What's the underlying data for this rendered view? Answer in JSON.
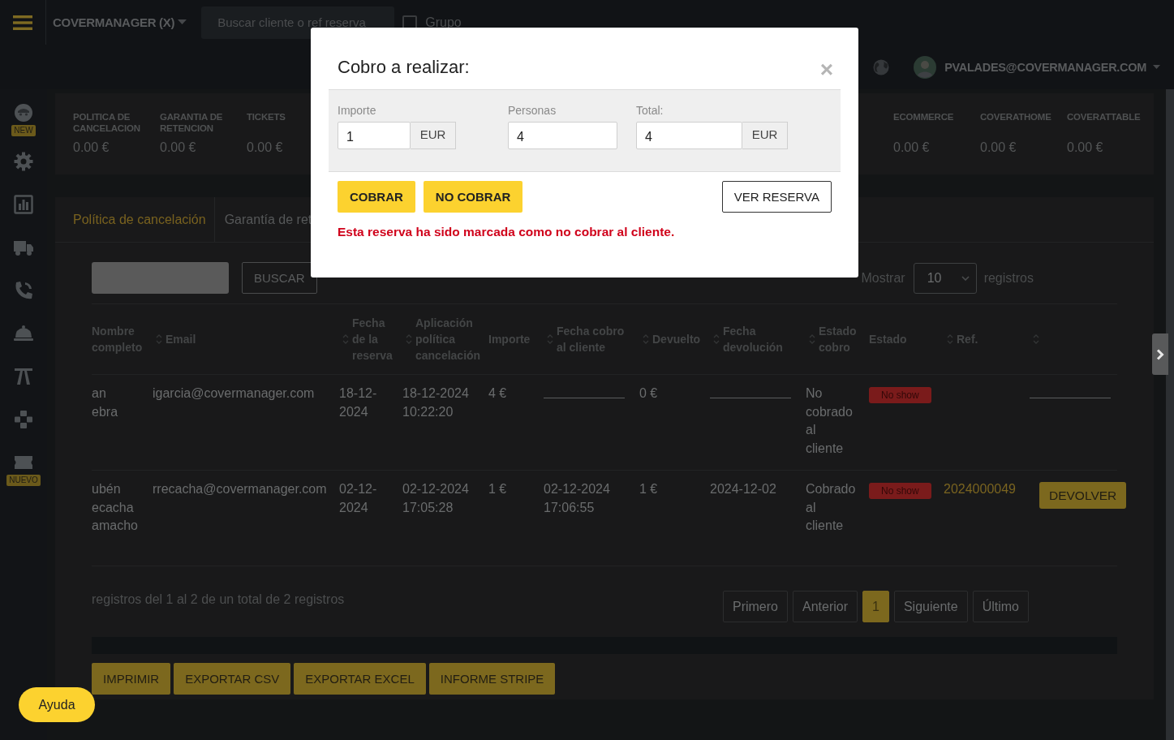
{
  "topbar": {
    "brand": "COVERMANAGER (X)",
    "search": {
      "placeholder": "Buscar cliente o ref reserva"
    },
    "group_checkbox": {
      "label": "Grupo",
      "checked": false
    },
    "user": {
      "email": "PVALADES@COVERMANAGER.COM"
    }
  },
  "sidebar": {
    "items": [
      {
        "kind": "face",
        "badge": "NEW"
      },
      {
        "kind": "gear"
      },
      {
        "kind": "chart"
      },
      {
        "kind": "truck"
      },
      {
        "kind": "phone"
      },
      {
        "kind": "cloche"
      },
      {
        "kind": "road"
      },
      {
        "kind": "gamepad"
      },
      {
        "kind": "ticket",
        "badge": "NUEVO"
      }
    ]
  },
  "stats": {
    "left": [
      {
        "label": "POLITICA DE CANCELACION",
        "value": "0.00 €"
      },
      {
        "label": "GARANTIA DE RETENCION",
        "value": "0.00 €"
      },
      {
        "label": "TICKETS",
        "value": "0.00 €"
      }
    ],
    "right": [
      {
        "label": "ECOMMERCE",
        "value": "0.00 €"
      },
      {
        "label": "COVERATHOME",
        "value": "0.00 €"
      },
      {
        "label": "COVERATTABLE",
        "value": "0.00 €"
      }
    ]
  },
  "panel": {
    "tabs": [
      {
        "label": "Política de cancelación",
        "selected": true
      },
      {
        "label": "Garantía de ret",
        "selected": false
      }
    ],
    "search_button": "BUSCAR",
    "length_menu": {
      "before": "Mostrar",
      "value": "10",
      "after": "registros"
    },
    "table": {
      "columns": [
        {
          "label": "Nombre completo",
          "sortable": false
        },
        {
          "label": "Email",
          "sortable": true
        },
        {
          "label": "Fecha de la reserva",
          "sortable": true
        },
        {
          "label": "Aplicación política cancelación",
          "sortable": true
        },
        {
          "label": "Importe",
          "sortable": false
        },
        {
          "label": "Fecha cobro al cliente",
          "sortable": true
        },
        {
          "label": "Devuelto",
          "sortable": true
        },
        {
          "label": "Fecha devolución",
          "sortable": true
        },
        {
          "label": "Estado cobro",
          "sortable": true
        },
        {
          "label": "Estado",
          "sortable": false
        },
        {
          "label": "Ref.",
          "sortable": true
        },
        {
          "sortable": true
        }
      ],
      "rows": [
        [
          {
            "kind": "text",
            "text": "an ebra"
          },
          {
            "kind": "text",
            "text": "igarcia@covermanager.com"
          },
          {
            "kind": "text",
            "text": "18-12-2024"
          },
          {
            "kind": "text",
            "text": "18-12-2024 10:22:20"
          },
          {
            "kind": "text",
            "text": "4 €"
          },
          {
            "kind": "line"
          },
          {
            "kind": "text",
            "text": "0 €"
          },
          {
            "kind": "line"
          },
          {
            "kind": "text",
            "text": "No cobrado al cliente"
          },
          {
            "kind": "badge",
            "text": "No show"
          },
          {
            "kind": "empty"
          },
          {
            "kind": "line"
          }
        ],
        [
          {
            "kind": "text",
            "text": "ubén ecacha amacho"
          },
          {
            "kind": "text",
            "text": "rrecacha@covermanager.com"
          },
          {
            "kind": "text",
            "text": "02-12-2024"
          },
          {
            "kind": "text",
            "text": "02-12-2024 17:05:28"
          },
          {
            "kind": "text",
            "text": "1 €"
          },
          {
            "kind": "text",
            "text": "02-12-2024 17:06:55"
          },
          {
            "kind": "text",
            "text": "1 €"
          },
          {
            "kind": "text",
            "text": "2024-12-02"
          },
          {
            "kind": "text",
            "text": "Cobrado al cliente"
          },
          {
            "kind": "badge",
            "text": "No show"
          },
          {
            "kind": "link",
            "text": "2024000049"
          },
          {
            "kind": "button",
            "text": "DEVOLVER"
          }
        ]
      ]
    },
    "info": "registros del 1 al 2 de un total de 2 registros",
    "pagination": [
      {
        "label": "Primero",
        "selected": false
      },
      {
        "label": "Anterior",
        "selected": false
      },
      {
        "label": "1",
        "selected": true
      },
      {
        "label": "Siguiente",
        "selected": false
      },
      {
        "label": "Último",
        "selected": false
      }
    ],
    "export_buttons": [
      "IMPRIMIR",
      "EXPORTAR CSV",
      "EXPORTAR EXCEL",
      "INFORME STRIPE"
    ]
  },
  "modal": {
    "title": "Cobro a realizar:",
    "close": "×",
    "fields": [
      {
        "label": "Importe",
        "value": "1",
        "addon": "EUR"
      },
      {
        "label": "Personas",
        "value": "4"
      },
      {
        "label": "Total:",
        "value": "4",
        "addon": "EUR"
      }
    ],
    "buttons": [
      {
        "label": "COBRAR",
        "kind": "primary"
      },
      {
        "label": "NO COBRAR",
        "kind": "primary"
      },
      {
        "label": "VER RESERVA",
        "kind": "outline"
      }
    ],
    "message": "Esta reserva ha sido marcada como no cobrar al cliente."
  },
  "help_button": "Ayuda"
}
